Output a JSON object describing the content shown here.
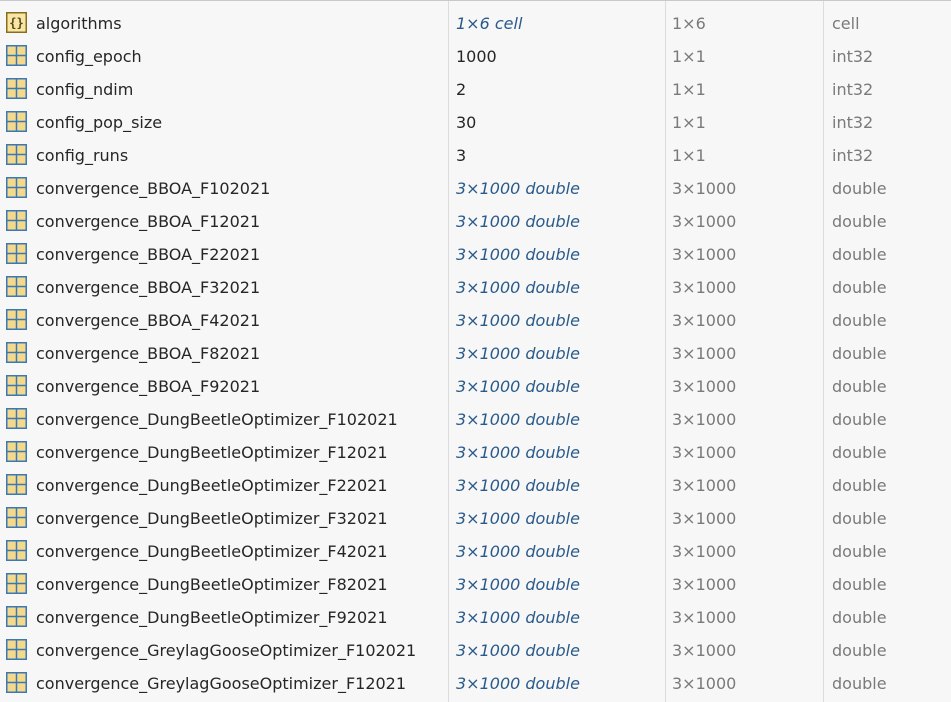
{
  "workspace": {
    "rows": [
      {
        "name": "algorithms",
        "value": "1×6 cell",
        "value_italic": true,
        "size": "1×6",
        "class": "cell",
        "icon": "cell-array-icon"
      },
      {
        "name": "config_epoch",
        "value": "1000",
        "value_italic": false,
        "size": "1×1",
        "class": "int32",
        "icon": "matrix-icon"
      },
      {
        "name": "config_ndim",
        "value": "2",
        "value_italic": false,
        "size": "1×1",
        "class": "int32",
        "icon": "matrix-icon"
      },
      {
        "name": "config_pop_size",
        "value": "30",
        "value_italic": false,
        "size": "1×1",
        "class": "int32",
        "icon": "matrix-icon"
      },
      {
        "name": "config_runs",
        "value": "3",
        "value_italic": false,
        "size": "1×1",
        "class": "int32",
        "icon": "matrix-icon"
      },
      {
        "name": "convergence_BBOA_F102021",
        "value": "3×1000 double",
        "value_italic": true,
        "size": "3×1000",
        "class": "double",
        "icon": "matrix-icon"
      },
      {
        "name": "convergence_BBOA_F12021",
        "value": "3×1000 double",
        "value_italic": true,
        "size": "3×1000",
        "class": "double",
        "icon": "matrix-icon"
      },
      {
        "name": "convergence_BBOA_F22021",
        "value": "3×1000 double",
        "value_italic": true,
        "size": "3×1000",
        "class": "double",
        "icon": "matrix-icon"
      },
      {
        "name": "convergence_BBOA_F32021",
        "value": "3×1000 double",
        "value_italic": true,
        "size": "3×1000",
        "class": "double",
        "icon": "matrix-icon"
      },
      {
        "name": "convergence_BBOA_F42021",
        "value": "3×1000 double",
        "value_italic": true,
        "size": "3×1000",
        "class": "double",
        "icon": "matrix-icon"
      },
      {
        "name": "convergence_BBOA_F82021",
        "value": "3×1000 double",
        "value_italic": true,
        "size": "3×1000",
        "class": "double",
        "icon": "matrix-icon"
      },
      {
        "name": "convergence_BBOA_F92021",
        "value": "3×1000 double",
        "value_italic": true,
        "size": "3×1000",
        "class": "double",
        "icon": "matrix-icon"
      },
      {
        "name": "convergence_DungBeetleOptimizer_F102021",
        "value": "3×1000 double",
        "value_italic": true,
        "size": "3×1000",
        "class": "double",
        "icon": "matrix-icon"
      },
      {
        "name": "convergence_DungBeetleOptimizer_F12021",
        "value": "3×1000 double",
        "value_italic": true,
        "size": "3×1000",
        "class": "double",
        "icon": "matrix-icon"
      },
      {
        "name": "convergence_DungBeetleOptimizer_F22021",
        "value": "3×1000 double",
        "value_italic": true,
        "size": "3×1000",
        "class": "double",
        "icon": "matrix-icon"
      },
      {
        "name": "convergence_DungBeetleOptimizer_F32021",
        "value": "3×1000 double",
        "value_italic": true,
        "size": "3×1000",
        "class": "double",
        "icon": "matrix-icon"
      },
      {
        "name": "convergence_DungBeetleOptimizer_F42021",
        "value": "3×1000 double",
        "value_italic": true,
        "size": "3×1000",
        "class": "double",
        "icon": "matrix-icon"
      },
      {
        "name": "convergence_DungBeetleOptimizer_F82021",
        "value": "3×1000 double",
        "value_italic": true,
        "size": "3×1000",
        "class": "double",
        "icon": "matrix-icon"
      },
      {
        "name": "convergence_DungBeetleOptimizer_F92021",
        "value": "3×1000 double",
        "value_italic": true,
        "size": "3×1000",
        "class": "double",
        "icon": "matrix-icon"
      },
      {
        "name": "convergence_GreylagGooseOptimizer_F102021",
        "value": "3×1000 double",
        "value_italic": true,
        "size": "3×1000",
        "class": "double",
        "icon": "matrix-icon"
      },
      {
        "name": "convergence_GreylagGooseOptimizer_F12021",
        "value": "3×1000 double",
        "value_italic": true,
        "size": "3×1000",
        "class": "double",
        "icon": "matrix-icon"
      }
    ]
  },
  "colors": {
    "background": "#f7f7f7",
    "name_text": "#262626",
    "italic_value_text": "#2a5a8a",
    "dim_text": "#7a7a7a",
    "matrix_icon_stroke": "#3b78b8",
    "matrix_icon_fill": "#f4d98a",
    "cell_icon_stroke": "#8a6d1a",
    "cell_icon_fill": "#f7e6a8"
  }
}
